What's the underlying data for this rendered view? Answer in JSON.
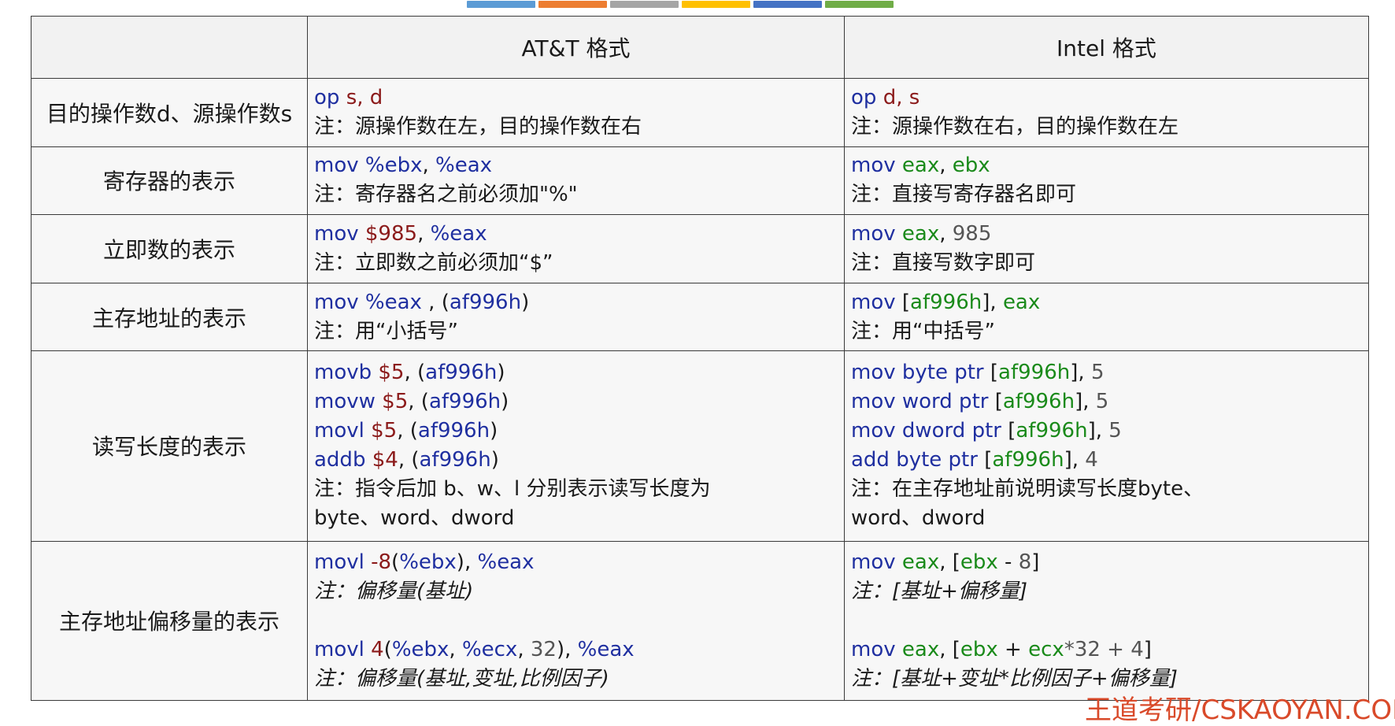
{
  "color_strip": [
    "#5b9bd5",
    "#ed7d31",
    "#a5a5a5",
    "#ffc000",
    "#4472c4",
    "#70ad47"
  ],
  "colors": {
    "keyword": "#1f2fa0",
    "operand_att": "#8b1a1a",
    "operand_intel": "#1a8a1a",
    "number": "#555555"
  },
  "header": {
    "col0": "",
    "col1": "AT&T 格式",
    "col2": "Intel 格式"
  },
  "rows": [
    {
      "label": "目的操作数d、源操作数s",
      "att": [
        [
          {
            "t": "op ",
            "c": "kw"
          },
          {
            "t": "s, d",
            "c": "red"
          }
        ],
        [
          {
            "t": "注：源操作数在左，目的操作数在右",
            "c": "txt"
          }
        ]
      ],
      "intel": [
        [
          {
            "t": "op ",
            "c": "kw"
          },
          {
            "t": "d, s",
            "c": "red"
          }
        ],
        [
          {
            "t": "注：源操作数在右，目的操作数在左",
            "c": "txt"
          }
        ]
      ]
    },
    {
      "label": "寄存器的表示",
      "att": [
        [
          {
            "t": "mov ",
            "c": "kw"
          },
          {
            "t": "%ebx",
            "c": "kw"
          },
          {
            "t": ", ",
            "c": "txt"
          },
          {
            "t": "%eax",
            "c": "kw"
          }
        ],
        [
          {
            "t": "注：寄存器名之前必须加\"%\"",
            "c": "txt"
          }
        ]
      ],
      "intel": [
        [
          {
            "t": "mov ",
            "c": "kw"
          },
          {
            "t": "eax",
            "c": "green"
          },
          {
            "t": ", ",
            "c": "txt"
          },
          {
            "t": "ebx",
            "c": "green"
          }
        ],
        [
          {
            "t": "注：直接写寄存器名即可",
            "c": "txt"
          }
        ]
      ]
    },
    {
      "label": "立即数的表示",
      "att": [
        [
          {
            "t": "mov ",
            "c": "kw"
          },
          {
            "t": "$985",
            "c": "red"
          },
          {
            "t": ", ",
            "c": "txt"
          },
          {
            "t": "%eax",
            "c": "kw"
          }
        ],
        [
          {
            "t": "注：立即数之前必须加“$”",
            "c": "txt"
          }
        ]
      ],
      "intel": [
        [
          {
            "t": "mov ",
            "c": "kw"
          },
          {
            "t": "eax",
            "c": "green"
          },
          {
            "t": ", ",
            "c": "txt"
          },
          {
            "t": "985",
            "c": "gray"
          }
        ],
        [
          {
            "t": "注：直接写数字即可",
            "c": "txt"
          }
        ]
      ]
    },
    {
      "label": "主存地址的表示",
      "att": [
        [
          {
            "t": "mov ",
            "c": "kw"
          },
          {
            "t": "%eax",
            "c": "kw"
          },
          {
            "t": " , (",
            "c": "txt"
          },
          {
            "t": "af996h",
            "c": "kw"
          },
          {
            "t": ")",
            "c": "txt"
          }
        ],
        [
          {
            "t": "注：用“小括号”",
            "c": "txt"
          }
        ]
      ],
      "intel": [
        [
          {
            "t": "mov ",
            "c": "kw"
          },
          {
            "t": "[",
            "c": "txt"
          },
          {
            "t": "af996h",
            "c": "green"
          },
          {
            "t": "], ",
            "c": "txt"
          },
          {
            "t": "eax",
            "c": "green"
          }
        ],
        [
          {
            "t": "注：用“中括号”",
            "c": "txt"
          }
        ]
      ]
    },
    {
      "label": "读写长度的表示",
      "att": [
        [
          {
            "t": "movb ",
            "c": "kw"
          },
          {
            "t": "$5",
            "c": "red"
          },
          {
            "t": ", (",
            "c": "txt"
          },
          {
            "t": "af996h",
            "c": "kw"
          },
          {
            "t": ")",
            "c": "txt"
          }
        ],
        [
          {
            "t": "movw ",
            "c": "kw"
          },
          {
            "t": "$5",
            "c": "red"
          },
          {
            "t": ", (",
            "c": "txt"
          },
          {
            "t": "af996h",
            "c": "kw"
          },
          {
            "t": ")",
            "c": "txt"
          }
        ],
        [
          {
            "t": "movl ",
            "c": "kw"
          },
          {
            "t": "$5",
            "c": "red"
          },
          {
            "t": ", (",
            "c": "txt"
          },
          {
            "t": "af996h",
            "c": "kw"
          },
          {
            "t": ")",
            "c": "txt"
          }
        ],
        [
          {
            "t": "addb ",
            "c": "kw"
          },
          {
            "t": "$4",
            "c": "red"
          },
          {
            "t": ", (",
            "c": "txt"
          },
          {
            "t": "af996h",
            "c": "kw"
          },
          {
            "t": ")",
            "c": "txt"
          }
        ],
        [
          {
            "t": "注：指令后加 b、w、l 分别表示读写长度为",
            "c": "txt"
          }
        ],
        [
          {
            "t": "byte、word、dword",
            "c": "txt"
          }
        ]
      ],
      "intel": [
        [
          {
            "t": "mov byte ptr ",
            "c": "kw"
          },
          {
            "t": "[",
            "c": "txt"
          },
          {
            "t": "af996h",
            "c": "green"
          },
          {
            "t": "], ",
            "c": "txt"
          },
          {
            "t": "5",
            "c": "gray"
          }
        ],
        [
          {
            "t": "mov word ptr ",
            "c": "kw"
          },
          {
            "t": "[",
            "c": "txt"
          },
          {
            "t": "af996h",
            "c": "green"
          },
          {
            "t": "], ",
            "c": "txt"
          },
          {
            "t": "5",
            "c": "gray"
          }
        ],
        [
          {
            "t": "mov dword ptr ",
            "c": "kw"
          },
          {
            "t": "[",
            "c": "txt"
          },
          {
            "t": "af996h",
            "c": "green"
          },
          {
            "t": "], ",
            "c": "txt"
          },
          {
            "t": "5",
            "c": "gray"
          }
        ],
        [
          {
            "t": "add byte ptr ",
            "c": "kw"
          },
          {
            "t": "[",
            "c": "txt"
          },
          {
            "t": "af996h",
            "c": "green"
          },
          {
            "t": "], ",
            "c": "txt"
          },
          {
            "t": "4",
            "c": "gray"
          }
        ],
        [
          {
            "t": "注：在主存地址前说明读写长度byte、",
            "c": "txt"
          }
        ],
        [
          {
            "t": "word、dword",
            "c": "txt"
          }
        ]
      ]
    },
    {
      "label": "主存地址偏移量的表示",
      "att": [
        [
          {
            "t": "movl ",
            "c": "kw"
          },
          {
            "t": "-8",
            "c": "red"
          },
          {
            "t": "(",
            "c": "txt"
          },
          {
            "t": "%ebx",
            "c": "kw"
          },
          {
            "t": "), ",
            "c": "txt"
          },
          {
            "t": "%eax",
            "c": "kw"
          }
        ],
        [
          {
            "t": "注：偏移量(基址)",
            "c": "it"
          }
        ],
        [],
        [
          {
            "t": "movl ",
            "c": "kw"
          },
          {
            "t": "4",
            "c": "red"
          },
          {
            "t": "(",
            "c": "txt"
          },
          {
            "t": "%ebx",
            "c": "kw"
          },
          {
            "t": ", ",
            "c": "txt"
          },
          {
            "t": "%ecx",
            "c": "kw"
          },
          {
            "t": ", ",
            "c": "txt"
          },
          {
            "t": "32",
            "c": "gray"
          },
          {
            "t": "), ",
            "c": "txt"
          },
          {
            "t": "%eax",
            "c": "kw"
          }
        ],
        [
          {
            "t": "注：偏移量(基址,变址,比例因子)",
            "c": "it"
          }
        ]
      ],
      "intel": [
        [
          {
            "t": "mov ",
            "c": "kw"
          },
          {
            "t": "eax",
            "c": "green"
          },
          {
            "t": ", [",
            "c": "txt"
          },
          {
            "t": "ebx",
            "c": "green"
          },
          {
            "t": " - ",
            "c": "txt"
          },
          {
            "t": "8",
            "c": "gray"
          },
          {
            "t": "]",
            "c": "txt"
          }
        ],
        [
          {
            "t": "注：[基址+偏移量]",
            "c": "it"
          }
        ],
        [],
        [
          {
            "t": "mov ",
            "c": "kw"
          },
          {
            "t": "eax",
            "c": "green"
          },
          {
            "t": ", [",
            "c": "txt"
          },
          {
            "t": "ebx",
            "c": "green"
          },
          {
            "t": " + ",
            "c": "txt"
          },
          {
            "t": "ecx",
            "c": "green"
          },
          {
            "t": "*32 + 4",
            "c": "gray"
          },
          {
            "t": "]",
            "c": "txt"
          }
        ],
        [
          {
            "t": "注：[基址+变址*比例因子+偏移量]",
            "c": "it"
          }
        ]
      ]
    }
  ],
  "watermark": "王道考研/CSKAOYAN.COM"
}
